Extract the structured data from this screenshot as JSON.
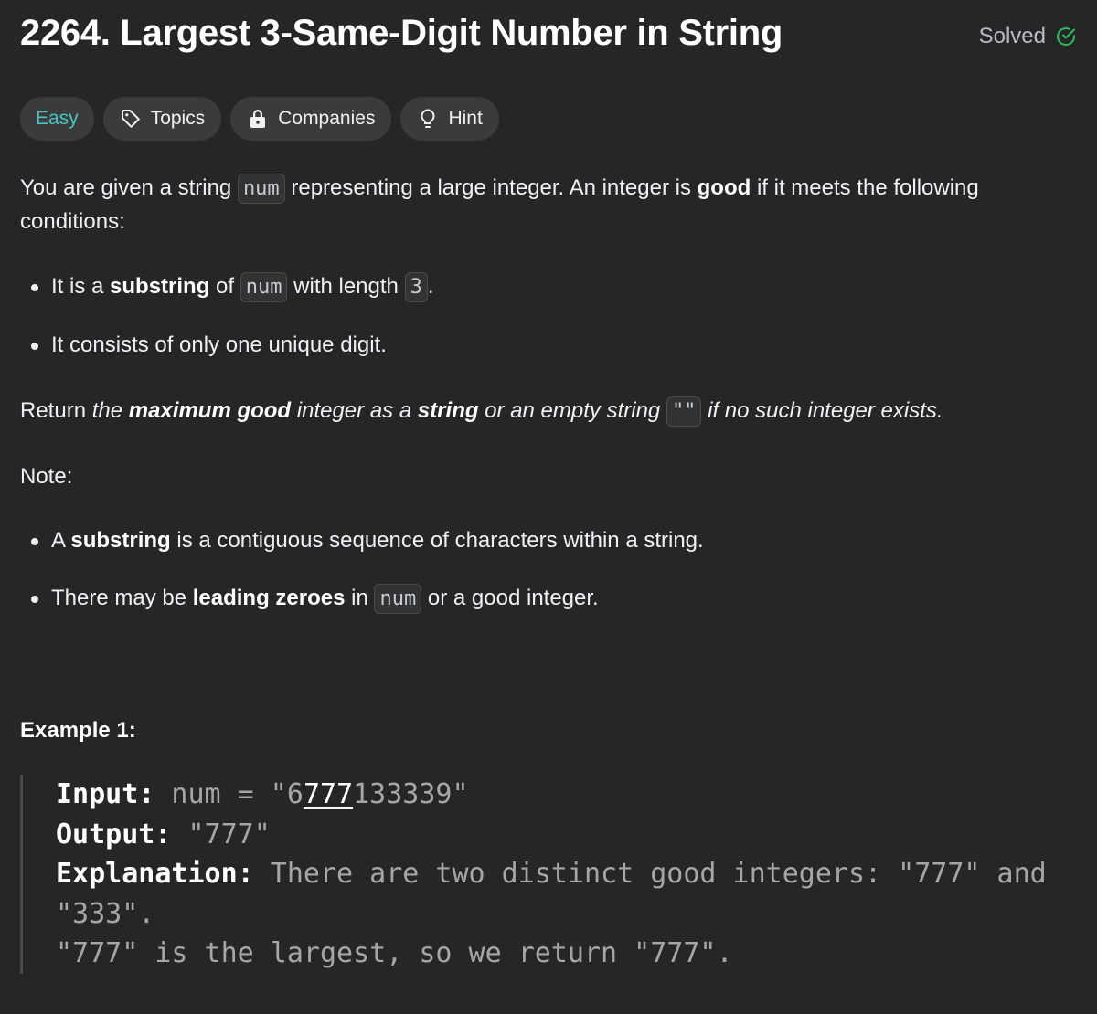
{
  "problem": {
    "title": "2264. Largest 3-Same-Digit Number in String",
    "status": "Solved"
  },
  "tags": {
    "difficulty": "Easy",
    "topics": "Topics",
    "companies": "Companies",
    "hint": "Hint"
  },
  "description": {
    "p1_a": "You are given a string ",
    "p1_code": "num",
    "p1_b": " representing a large integer. An integer is ",
    "p1_bold": "good",
    "p1_c": " if it meets the following conditions:",
    "cond1_a": "It is a ",
    "cond1_bold": "substring",
    "cond1_b": " of ",
    "cond1_code": "num",
    "cond1_c": " with length ",
    "cond1_code2": "3",
    "cond1_d": ".",
    "cond2": "It consists of only one unique digit.",
    "p2_a": "Return ",
    "p2_i1": "the ",
    "p2_bi1": "maximum good",
    "p2_i2": " integer as a ",
    "p2_bi2": "string",
    "p2_i3": " or an empty string ",
    "p2_code": "\"\"",
    "p2_i4": " if no such integer exists.",
    "note_label": "Note:",
    "note1_a": "A ",
    "note1_bold": "substring",
    "note1_b": " is a contiguous sequence of characters within a string.",
    "note2_a": "There may be ",
    "note2_bold": "leading zeroes",
    "note2_b": " in ",
    "note2_code": "num",
    "note2_c": " or a good integer."
  },
  "example1": {
    "title": "Example 1:",
    "input_label": "Input:",
    "input_a": " num = \"6",
    "input_u": "777",
    "input_b": "133339\"",
    "output_label": "Output:",
    "output_value": " \"777\"",
    "explanation_label": "Explanation:",
    "explanation_1": " There are two distinct good integers: \"777\" and",
    "explanation_2": "\"333\".",
    "explanation_3": "\"777\" is the largest, so we return \"777\"."
  },
  "colors": {
    "background": "#262626",
    "easy": "#46c6c2",
    "solved_check": "#2cbb5d"
  },
  "icons": [
    "check-circle-icon",
    "tag-icon",
    "lock-icon",
    "lightbulb-icon"
  ]
}
